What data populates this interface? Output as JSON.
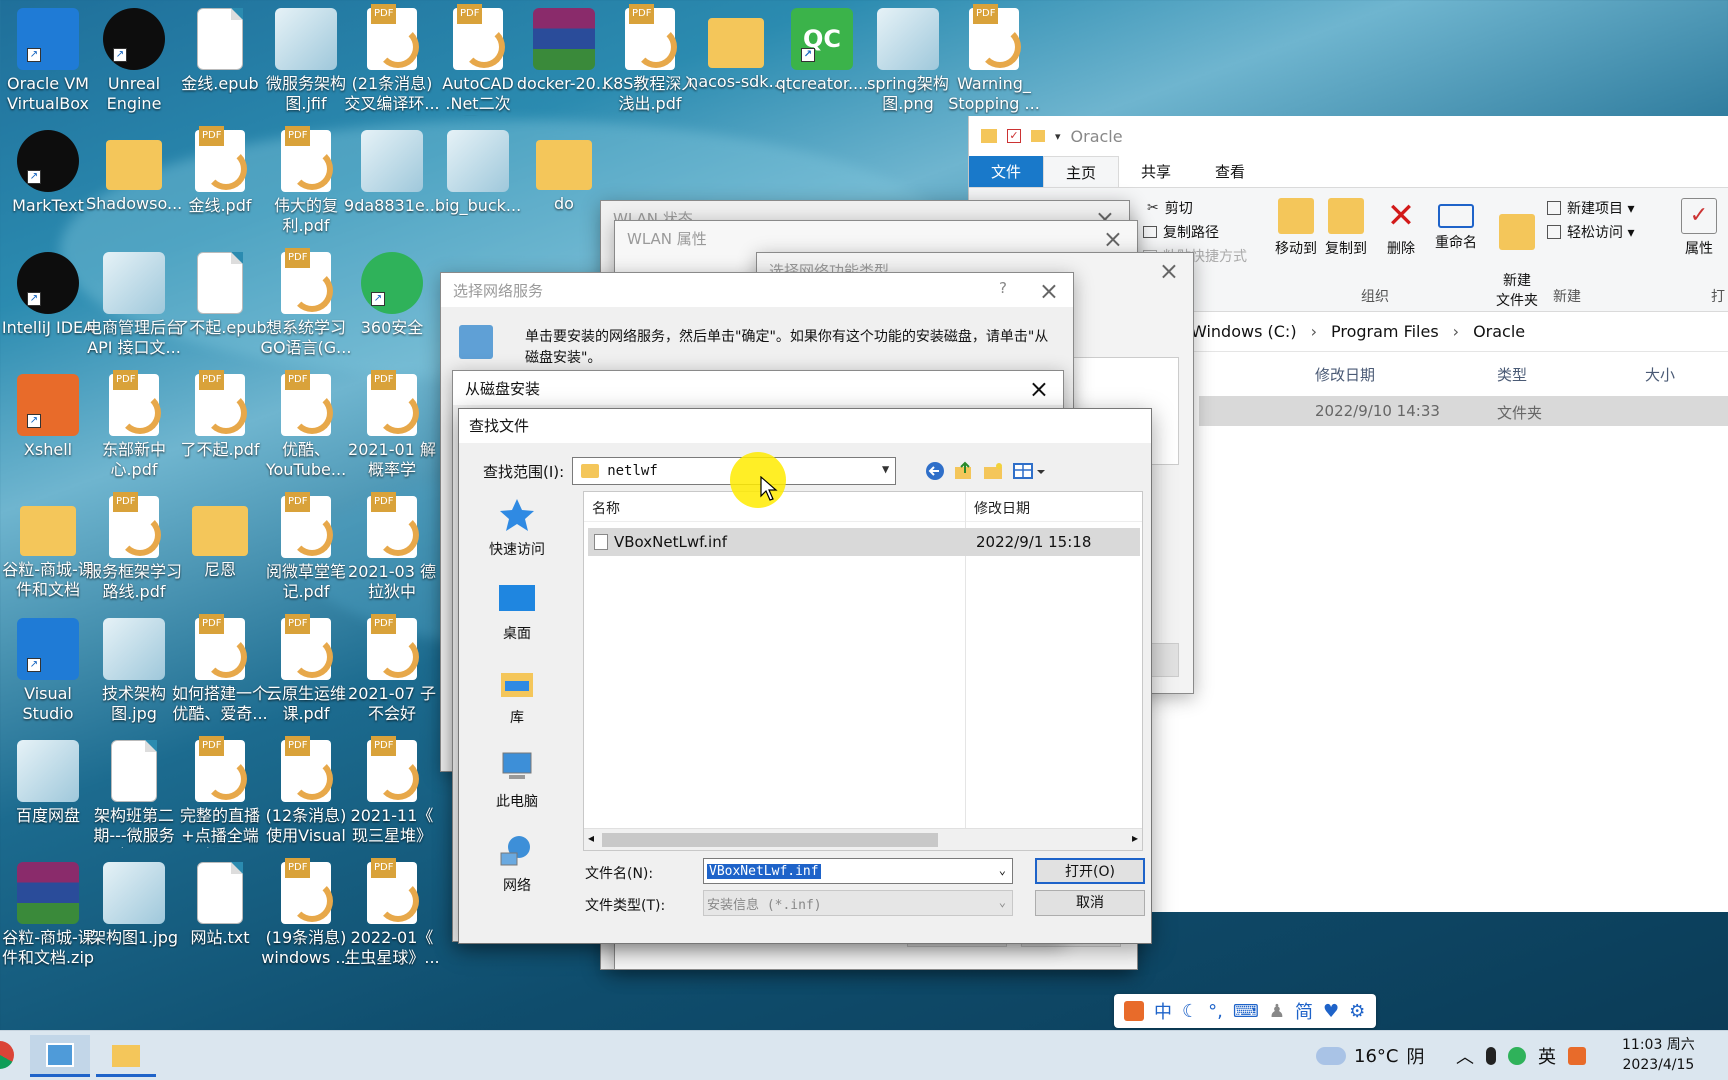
{
  "desktop": {
    "icons": [
      {
        "label": "Oracle VM VirtualBox",
        "icon": "virtualbox-icon"
      },
      {
        "label": "Unreal Engine",
        "icon": "unreal-icon"
      },
      {
        "label": "金线.epub",
        "icon": "document-icon"
      },
      {
        "label": "微服务架构图.jfif",
        "icon": "image-icon"
      },
      {
        "label": "(21条消息) 交叉编译环...",
        "icon": "pdf-icon"
      },
      {
        "label": "AutoCAD .Net二次开...",
        "icon": "pdf-icon"
      },
      {
        "label": "docker-20...",
        "icon": "archive-icon"
      },
      {
        "label": "K8S教程深入浅出.pdf",
        "icon": "pdf-icon"
      },
      {
        "label": "nacos-sdk...",
        "icon": "folder-icon"
      },
      {
        "label": "qtcreator....",
        "icon": "qtcreator-icon"
      },
      {
        "label": "spring架构图.png",
        "icon": "image-icon"
      },
      {
        "label": "Warning_ Stopping ...",
        "icon": "pdf-icon"
      },
      {
        "label": "MarkText",
        "icon": "marktext-icon"
      },
      {
        "label": "Shadowso...",
        "icon": "folder-icon"
      },
      {
        "label": "金线.pdf",
        "icon": "pdf-icon"
      },
      {
        "label": "伟大的复利.pdf",
        "icon": "pdf-icon"
      },
      {
        "label": "9da8831e...",
        "icon": "image-icon"
      },
      {
        "label": "big_buck...",
        "icon": "video-icon"
      },
      {
        "label": "do",
        "icon": "folder-icon"
      },
      {
        "label": "IntelliJ IDEA",
        "icon": "intellij-icon"
      },
      {
        "label": "电商管理后台API 接口文...",
        "icon": "notepad-icon"
      },
      {
        "label": "了不起.epub",
        "icon": "document-icon"
      },
      {
        "label": "想系统学习GO语言(G...",
        "icon": "pdf-icon"
      },
      {
        "label": "360安全",
        "icon": "security-360-icon"
      },
      {
        "label": "Xshell",
        "icon": "xshell-icon"
      },
      {
        "label": "东部新中心.pdf",
        "icon": "pdf-icon"
      },
      {
        "label": "了不起.pdf",
        "icon": "pdf-icon"
      },
      {
        "label": "优酷、YouTube...",
        "icon": "pdf-icon"
      },
      {
        "label": "2021-01 解概率学",
        "icon": "pdf-icon"
      },
      {
        "label": "谷粒-商城-课件和文档",
        "icon": "folder-icon"
      },
      {
        "label": "服务框架学习路线.pdf",
        "icon": "pdf-icon"
      },
      {
        "label": "尼恩",
        "icon": "folder-icon"
      },
      {
        "label": "阅微草堂笔记.pdf",
        "icon": "pdf-icon"
      },
      {
        "label": "2021-03 德拉狄中",
        "icon": "pdf-icon"
      },
      {
        "label": "Visual Studio Code",
        "icon": "vscode-icon"
      },
      {
        "label": "技术架构图.jpg",
        "icon": "image-icon"
      },
      {
        "label": "如何搭建一个优酷、爱奇...",
        "icon": "pdf-icon"
      },
      {
        "label": "云原生运维课.pdf",
        "icon": "pdf-icon"
      },
      {
        "label": "2021-07 子不会好",
        "icon": "pdf-icon"
      },
      {
        "label": "百度网盘",
        "icon": "baidu-netdisk-icon"
      },
      {
        "label": "架构班第二期---微服务架...",
        "icon": "document-icon"
      },
      {
        "label": "完整的直播+点播全端解...",
        "icon": "pdf-icon"
      },
      {
        "label": "(12条消息) 使用Visual ...",
        "icon": "pdf-icon"
      },
      {
        "label": "2021-11《 现三星堆》",
        "icon": "pdf-icon"
      },
      {
        "label": "谷粒-商城-课件和文档.zip",
        "icon": "archive-icon"
      },
      {
        "label": "架构图1.jpg",
        "icon": "image-icon"
      },
      {
        "label": "网站.txt",
        "icon": "document-icon"
      },
      {
        "label": "(19条消息) windows ...",
        "icon": "pdf-icon"
      },
      {
        "label": "2022-01《 生虫星球》...",
        "icon": "pdf-icon"
      }
    ]
  },
  "explorer": {
    "title": "Oracle",
    "tabs": [
      "文件",
      "主页",
      "共享",
      "查看"
    ],
    "ribbon": {
      "cut": "剪切",
      "copy_path": "复制路径",
      "paste_shortcut": "粘贴快捷方式",
      "move_to": "移动到",
      "copy_to": "复制到",
      "delete": "删除",
      "rename": "重命名",
      "new_folder": "新建\n文件夹",
      "new_item": "新建项目 ▾",
      "easy_access": "轻松访问 ▾",
      "properties": "属性",
      "group_organize": "组织",
      "group_new": "新建",
      "group_open": "打"
    },
    "breadcrumb": [
      "Windows (C:)",
      "Program Files",
      "Oracle"
    ],
    "columns": [
      "修改日期",
      "类型",
      "大小"
    ],
    "row": {
      "date": "2022/9/10 14:33",
      "type": "文件夹"
    }
  },
  "bg_dialogs": {
    "wlan_status": "WLAN 状态",
    "wlan_props": "WLAN 属性",
    "select_feature_type": "选择网络功能类型",
    "select_service_title": "选择网络服务",
    "select_service_help": "?",
    "select_service_text": "单击要安装的网络服务，然后单击\"确定\"。如果你有这个功能的安装磁盘，请单击\"从磁盘安装\"。",
    "install_from_disk": "从磁盘安装"
  },
  "find_dialog": {
    "title": "查找文件",
    "look_in_label": "查找范围(I):",
    "look_in_value": "netlwf",
    "places": [
      "快速访问",
      "桌面",
      "库",
      "此电脑",
      "网络"
    ],
    "list_headers": [
      "名称",
      "修改日期"
    ],
    "files": [
      {
        "name": "VBoxNetLwf.inf",
        "date": "2022/9/1 15:18"
      }
    ],
    "filename_label": "文件名(N):",
    "filename_value": "VBoxNetLwf.inf",
    "filetype_label": "文件类型(T):",
    "filetype_value": "安装信息 (*.inf)",
    "open_button": "打开(O)",
    "cancel_button": "取消"
  },
  "taskbar": {
    "weather_temp": "16°C",
    "weather_text": "阴",
    "ime_lang": "英",
    "time": "11:03 周六",
    "date": "2023/4/15"
  },
  "ime_toolbar": {
    "items": [
      "中",
      "简"
    ]
  }
}
